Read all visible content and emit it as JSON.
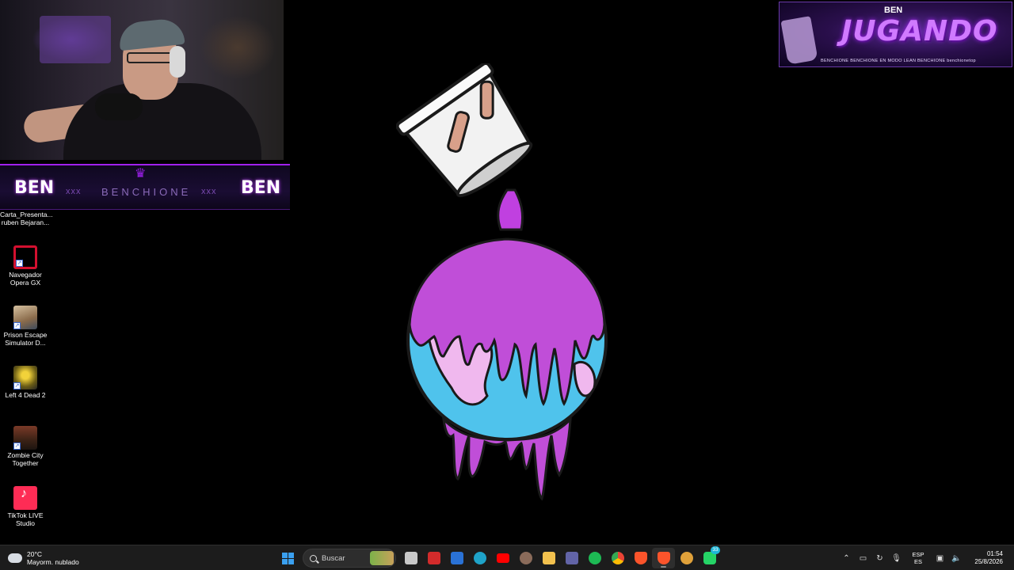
{
  "desktop": {
    "icons": [
      {
        "label_line1": "Carta_Presenta...",
        "label_line2": "ruben Bejaran...",
        "icon": "document-icon"
      },
      {
        "label_line1": "Navegador",
        "label_line2": "Opera GX",
        "icon": "opera-gx-icon"
      },
      {
        "label_line1": "Prison Escape",
        "label_line2": "Simulator D...",
        "icon": "prison-escape-icon"
      },
      {
        "label_line1": "Left 4 Dead 2",
        "label_line2": "",
        "icon": "left4dead2-icon"
      },
      {
        "label_line1": "Zombie City",
        "label_line2": "Together",
        "icon": "zombie-city-icon"
      },
      {
        "label_line1": "TikTok LIVE",
        "label_line2": "Studio",
        "icon": "tiktok-live-icon"
      }
    ]
  },
  "overlay": {
    "banner": {
      "logo_left": "BEN",
      "logo_right": "BEN",
      "xxx_left": "xxx",
      "xxx_right": "xxx",
      "name": "BENCHIONE",
      "crown": "♛"
    },
    "jugando": {
      "title": "JUGANDO",
      "logo": "BEN",
      "strip": "BENCHIONE   BENCHIONE   EN MODO LEAN   BENCHIONE   benchionetop"
    }
  },
  "taskbar": {
    "weather": {
      "temp": "20°C",
      "desc": "Mayorm. nublado"
    },
    "search_placeholder": "Buscar",
    "apps": [
      {
        "name": "file-explorer",
        "icon": "task-view-icon",
        "color": "#c8c8c8"
      },
      {
        "name": "amd",
        "icon": "amd-software-icon",
        "color": "#d22b2b"
      },
      {
        "name": "outlook",
        "icon": "outlook-icon",
        "color": "#2a72d6"
      },
      {
        "name": "edge",
        "icon": "edge-icon",
        "color": "#1fa3c9"
      },
      {
        "name": "youtube",
        "icon": "youtube-icon",
        "color": "#ff0000"
      },
      {
        "name": "profile",
        "icon": "avatar-icon",
        "color": "#8a6b5a"
      },
      {
        "name": "explorer",
        "icon": "folder-icon",
        "color": "#f2c14e"
      },
      {
        "name": "teams",
        "icon": "teams-icon",
        "color": "#6264a7"
      },
      {
        "name": "spotify",
        "icon": "spotify-icon",
        "color": "#1db954"
      },
      {
        "name": "chrome",
        "icon": "chrome-icon",
        "color": "#4285f4"
      },
      {
        "name": "brave",
        "icon": "brave-icon",
        "color": "#fb542b"
      },
      {
        "name": "brave-active",
        "icon": "brave-icon",
        "color": "#fb542b"
      },
      {
        "name": "app-unknown",
        "icon": "app-icon",
        "color": "#e0a13a"
      },
      {
        "name": "whatsapp",
        "icon": "whatsapp-icon",
        "color": "#25d366",
        "badge": "33"
      }
    ],
    "tray": {
      "chevron": "^",
      "lang_line1": "ESP",
      "lang_line2": "ES",
      "time": "01:54",
      "date": "25/8/2026"
    }
  }
}
